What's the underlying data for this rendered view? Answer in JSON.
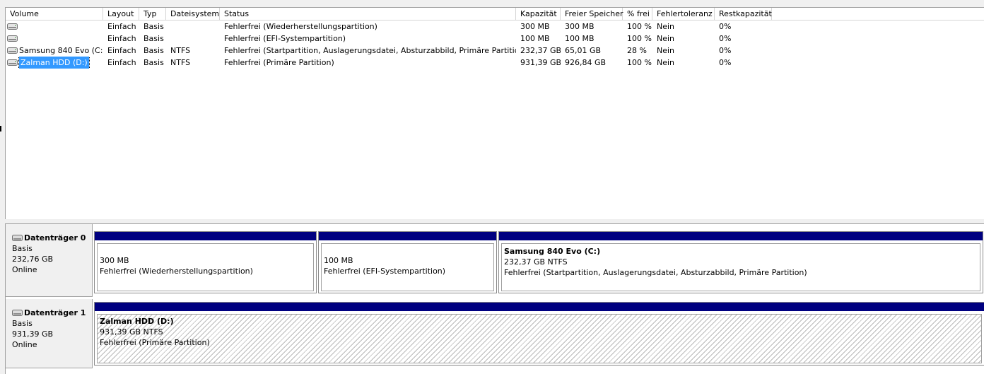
{
  "columns": [
    "Volume",
    "Layout",
    "Typ",
    "Dateisystem",
    "Status",
    "Kapazität",
    "Freier Speicher",
    "% frei",
    "Fehlertoleranz",
    "Restkapazität"
  ],
  "volumes": [
    {
      "volume": "",
      "layout": "Einfach",
      "typ": "Basis",
      "fs": "",
      "status": "Fehlerfrei (Wiederherstellungspartition)",
      "kapazitaet": "300 MB",
      "frei": "300 MB",
      "prozent": "100 %",
      "fehlertoleranz": "Nein",
      "rest": "0%",
      "selected": false
    },
    {
      "volume": "",
      "layout": "Einfach",
      "typ": "Basis",
      "fs": "",
      "status": "Fehlerfrei (EFI-Systempartition)",
      "kapazitaet": "100 MB",
      "frei": "100 MB",
      "prozent": "100 %",
      "fehlertoleranz": "Nein",
      "rest": "0%",
      "selected": false
    },
    {
      "volume": "Samsung 840 Evo (C:)",
      "layout": "Einfach",
      "typ": "Basis",
      "fs": "NTFS",
      "status": "Fehlerfrei (Startpartition, Auslagerungsdatei, Absturzabbild, Primäre Partition)",
      "kapazitaet": "232,37 GB",
      "frei": "65,01 GB",
      "prozent": "28 %",
      "fehlertoleranz": "Nein",
      "rest": "0%",
      "selected": false
    },
    {
      "volume": "Zalman HDD (D:)",
      "layout": "Einfach",
      "typ": "Basis",
      "fs": "NTFS",
      "status": "Fehlerfrei (Primäre Partition)",
      "kapazitaet": "931,39 GB",
      "frei": "926,84 GB",
      "prozent": "100 %",
      "fehlertoleranz": "Nein",
      "rest": "0%",
      "selected": true
    }
  ],
  "disks": [
    {
      "name": "Datenträger 0",
      "type": "Basis",
      "size": "232,76 GB",
      "state": "Online",
      "partitions": [
        {
          "title": "",
          "size": "300 MB",
          "status": "Fehlerfrei (Wiederherstellungspartition)",
          "hatched": false
        },
        {
          "title": "",
          "size": "100 MB",
          "status": "Fehlerfrei (EFI-Systempartition)",
          "hatched": false
        },
        {
          "title": "Samsung 840 Evo  (C:)",
          "size": "232,37 GB NTFS",
          "status": "Fehlerfrei (Startpartition, Auslagerungsdatei, Absturzabbild, Primäre Partition)",
          "hatched": false
        }
      ]
    },
    {
      "name": "Datenträger 1",
      "type": "Basis",
      "size": "931,39 GB",
      "state": "Online",
      "partitions": [
        {
          "title": "Zalman HDD  (D:)",
          "size": "931,39 GB NTFS",
          "status": "Fehlerfrei (Primäre Partition)",
          "hatched": true
        }
      ]
    }
  ],
  "colors": {
    "partition_bar": "#000080",
    "selection": "#3399ff"
  },
  "icons": {
    "volume": "disk-drive-icon",
    "disk": "hard-disk-icon"
  }
}
